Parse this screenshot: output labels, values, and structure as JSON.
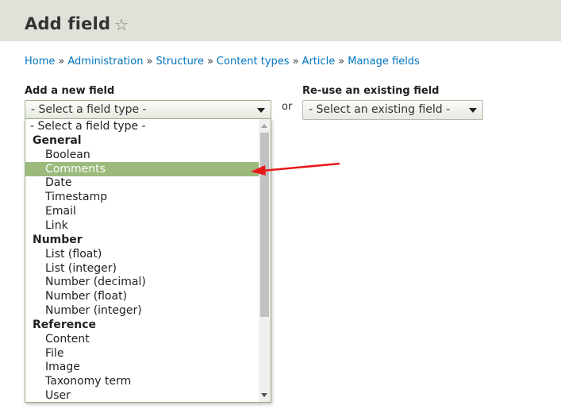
{
  "header": {
    "title": "Add field",
    "shortcut_icon": "star-outline-icon"
  },
  "breadcrumb": [
    {
      "label": "Home"
    },
    {
      "label": "Administration"
    },
    {
      "label": "Structure"
    },
    {
      "label": "Content types"
    },
    {
      "label": "Article"
    },
    {
      "label": "Manage fields"
    }
  ],
  "breadcrumb_separator": "»",
  "add_new": {
    "label": "Add a new field",
    "selected": "- Select a field type -"
  },
  "or_text": "or",
  "reuse": {
    "label": "Re-use an existing field",
    "selected": "- Select an existing field -"
  },
  "dropdown": {
    "options": [
      {
        "label": "- Select a field type -",
        "kind": "placeholder"
      },
      {
        "label": "General",
        "kind": "group"
      },
      {
        "label": "Boolean",
        "kind": "option"
      },
      {
        "label": "Comments",
        "kind": "option",
        "highlighted": true
      },
      {
        "label": "Date",
        "kind": "option"
      },
      {
        "label": "Timestamp",
        "kind": "option"
      },
      {
        "label": "Email",
        "kind": "option"
      },
      {
        "label": "Link",
        "kind": "option"
      },
      {
        "label": "Number",
        "kind": "group"
      },
      {
        "label": "List (float)",
        "kind": "option"
      },
      {
        "label": "List (integer)",
        "kind": "option"
      },
      {
        "label": "Number (decimal)",
        "kind": "option"
      },
      {
        "label": "Number (float)",
        "kind": "option"
      },
      {
        "label": "Number (integer)",
        "kind": "option"
      },
      {
        "label": "Reference",
        "kind": "group"
      },
      {
        "label": "Content",
        "kind": "option"
      },
      {
        "label": "File",
        "kind": "option"
      },
      {
        "label": "Image",
        "kind": "option"
      },
      {
        "label": "Taxonomy term",
        "kind": "option"
      },
      {
        "label": "User",
        "kind": "option"
      }
    ]
  },
  "colors": {
    "header_bg": "#e1e0d9",
    "link": "#0074bd",
    "highlight": "#9bba7b",
    "annotation_arrow": "#e8191b"
  }
}
